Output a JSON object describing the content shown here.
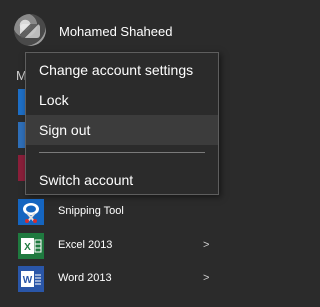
{
  "user": {
    "name": "Mohamed Shaheed"
  },
  "section_letter": "M",
  "account_menu": {
    "items": [
      {
        "label": "Change account settings"
      },
      {
        "label": "Lock"
      },
      {
        "label": "Sign out",
        "highlighted": true
      },
      {
        "label": "Switch account"
      }
    ]
  },
  "apps": [
    {
      "label": "Snipping Tool",
      "icon": "snipping-tool-icon",
      "color": "#1565c0",
      "has_submenu": false
    },
    {
      "label": "Excel 2013",
      "icon": "excel-icon",
      "color": "#1f7a3f",
      "has_submenu": true
    },
    {
      "label": "Word 2013",
      "icon": "word-icon",
      "color": "#2a56a8",
      "has_submenu": true
    }
  ],
  "chevron_glyph": ">",
  "colors": {
    "background": "#2b2b2b",
    "menu_hover": "#3c3c3c",
    "menu_border": "#5e5e5e"
  }
}
